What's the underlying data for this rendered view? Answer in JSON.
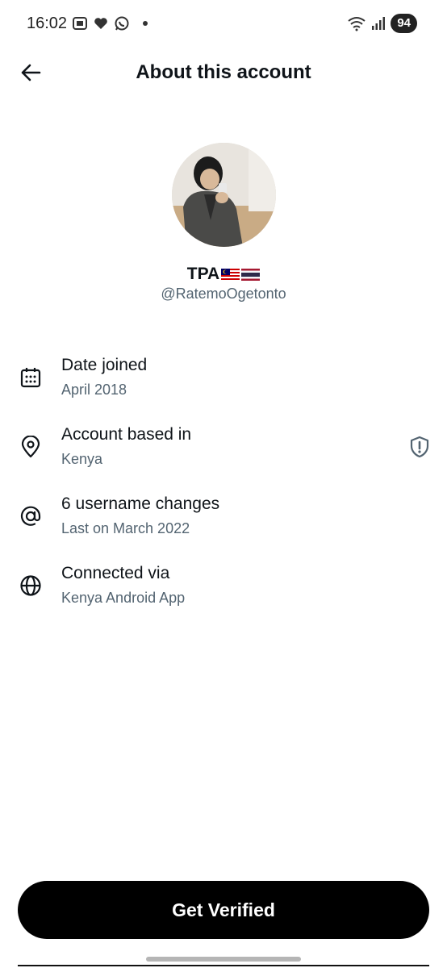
{
  "status_bar": {
    "time": "16:02",
    "battery": "94"
  },
  "header": {
    "title": "About this account"
  },
  "profile": {
    "display_name": "TPA",
    "handle": "@RatemoOgetonto"
  },
  "info": {
    "date_joined": {
      "title": "Date joined",
      "value": "April 2018",
      "icon": "calendar-icon"
    },
    "based_in": {
      "title": "Account based in",
      "value": "Kenya",
      "icon": "location-pin-icon"
    },
    "username_changes": {
      "title": "6 username changes",
      "value": "Last on March 2022",
      "icon": "at-sign-icon"
    },
    "connected_via": {
      "title": "Connected via",
      "value": "Kenya Android App",
      "icon": "globe-icon"
    }
  },
  "actions": {
    "verify_label": "Get Verified"
  },
  "colors": {
    "primary_text": "#0f1419",
    "secondary_text": "#536471",
    "button_bg": "#000000"
  }
}
